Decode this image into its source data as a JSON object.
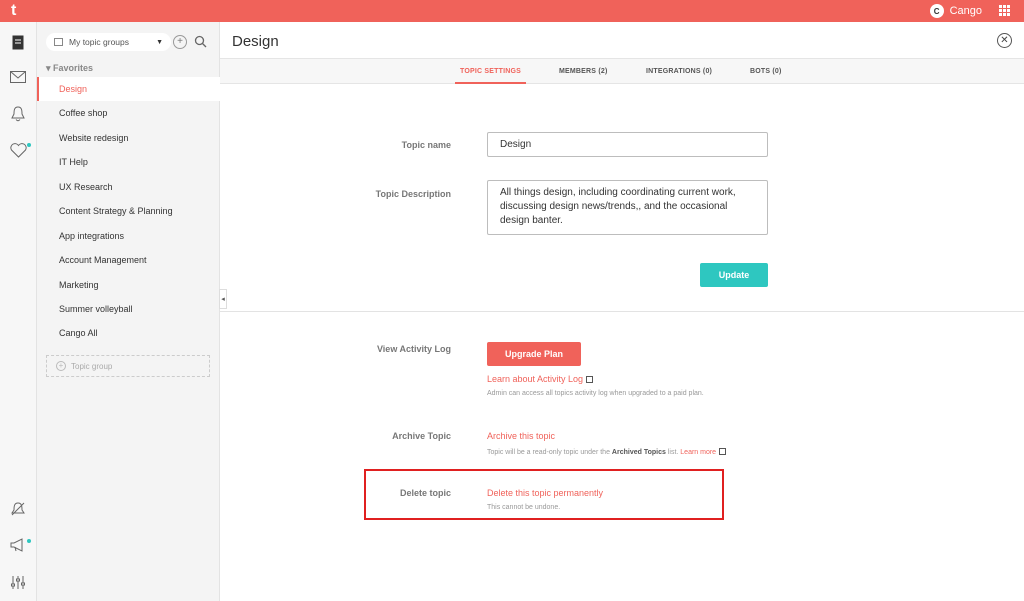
{
  "topbar": {
    "logo": "t",
    "user_initial": "C",
    "user_name": "Cango"
  },
  "sidebar": {
    "groups_select": "My topic groups",
    "favorites_label": "Favorites",
    "items": [
      {
        "label": "Design"
      },
      {
        "label": "Coffee shop"
      },
      {
        "label": "Website redesign"
      },
      {
        "label": "IT Help"
      },
      {
        "label": "UX Research"
      },
      {
        "label": "Content Strategy & Planning"
      },
      {
        "label": "App integrations"
      },
      {
        "label": "Account Management"
      },
      {
        "label": "Marketing"
      },
      {
        "label": "Summer volleyball"
      },
      {
        "label": "Cango All"
      }
    ],
    "topic_group_placeholder": "Topic group"
  },
  "main": {
    "title": "Design",
    "tabs": [
      {
        "label": "TOPIC SETTINGS"
      },
      {
        "label": "MEMBERS (2)"
      },
      {
        "label": "INTEGRATIONS (0)"
      },
      {
        "label": "BOTS (0)"
      }
    ],
    "topic_name_label": "Topic name",
    "topic_name_value": "Design",
    "topic_description_label": "Topic Description",
    "topic_description_value": "All things design, including coordinating current work, discussing design news/trends,, and the occasional design banter.",
    "update_button": "Update",
    "activity_log_label": "View Activity Log",
    "upgrade_button": "Upgrade Plan",
    "activity_log_link": "Learn about Activity Log",
    "activity_log_note": "Admin can access all topics activity log when upgraded to a paid plan.",
    "archive_label": "Archive Topic",
    "archive_link": "Archive this topic",
    "archive_note_pre": "Topic will be a read-only topic under the",
    "archive_note_bold": "Archived Topics",
    "archive_note_post": "list.",
    "archive_learn_more": "Learn more",
    "delete_label": "Delete topic",
    "delete_link": "Delete this topic permanently",
    "delete_note": "This cannot be undone."
  },
  "colors": {
    "brand": "#f0625a",
    "accent": "#2ec7c0"
  }
}
